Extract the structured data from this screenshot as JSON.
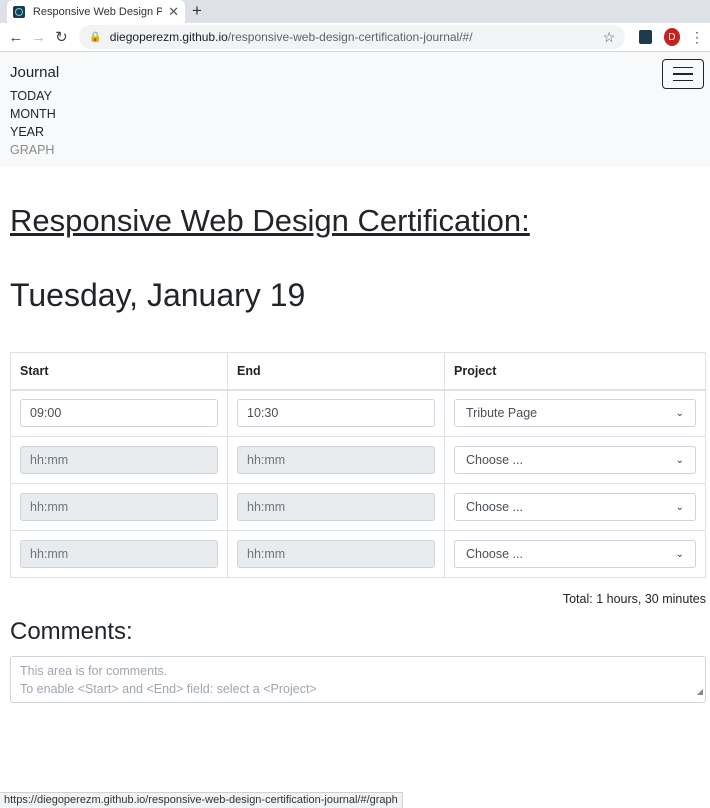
{
  "browser": {
    "tab_title": "Responsive Web Design Pr",
    "url_host": "diegoperezm.github.io",
    "url_path": "/responsive-web-design-certification-journal/#/",
    "avatar_letter": "D",
    "status_url": "https://diegoperezm.github.io/responsive-web-design-certification-journal/#/graph"
  },
  "nav": {
    "brand": "Journal",
    "links": [
      "TODAY",
      "MONTH",
      "YEAR",
      "GRAPH"
    ]
  },
  "main": {
    "heading": "Responsive Web Design Certification:",
    "date": "Tuesday, January 19",
    "table": {
      "headers": [
        "Start",
        "End",
        "Project"
      ],
      "rows": [
        {
          "start": "09:00",
          "end": "10:30",
          "project": "Tribute Page",
          "enabled": true
        },
        {
          "start_placeholder": "hh:mm",
          "end_placeholder": "hh:mm",
          "project": "Choose ...",
          "enabled": false
        },
        {
          "start_placeholder": "hh:mm",
          "end_placeholder": "hh:mm",
          "project": "Choose ...",
          "enabled": false
        },
        {
          "start_placeholder": "hh:mm",
          "end_placeholder": "hh:mm",
          "project": "Choose ...",
          "enabled": false
        }
      ]
    },
    "total": "Total: 1 hours, 30 minutes",
    "comments_title": "Comments:",
    "comments_placeholder_line1": "This area is for comments.",
    "comments_placeholder_line2": "To enable <Start> and <End> field: select a <Project>"
  }
}
